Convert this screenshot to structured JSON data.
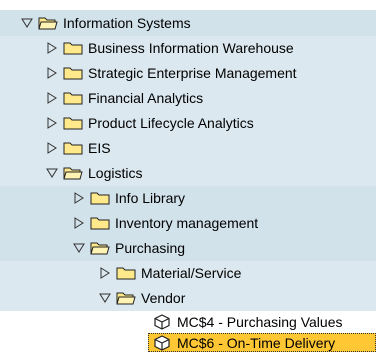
{
  "tree": {
    "root": {
      "label": "Information Systems",
      "expanded": true
    },
    "level1": [
      {
        "label": "Business Information Warehouse",
        "expanded": false
      },
      {
        "label": "Strategic Enterprise Management",
        "expanded": false
      },
      {
        "label": "Financial Analytics",
        "expanded": false
      },
      {
        "label": "Product Lifecycle Analytics",
        "expanded": false
      },
      {
        "label": "EIS",
        "expanded": false
      },
      {
        "label": "Logistics",
        "expanded": true
      }
    ],
    "logistics_children": [
      {
        "label": "Info Library",
        "expanded": false
      },
      {
        "label": "Inventory management",
        "expanded": false
      },
      {
        "label": "Purchasing",
        "expanded": true
      }
    ],
    "purchasing_children": [
      {
        "label": "Material/Service",
        "expanded": false
      },
      {
        "label": "Vendor",
        "expanded": true
      }
    ],
    "vendor_transactions": [
      {
        "label": "MC$4 - Purchasing Values",
        "selected": false
      },
      {
        "label": "MC$6 - On-Time Delivery",
        "selected": true
      }
    ]
  },
  "colors": {
    "band_dark": "#d2e2eb",
    "band_light": "#dbe8ef",
    "folder_fill": "#ffe98a",
    "selection": "#ffc733"
  }
}
